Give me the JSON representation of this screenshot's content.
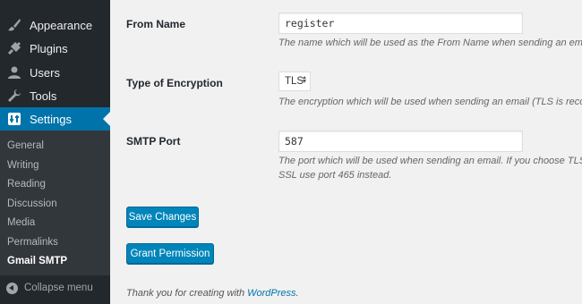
{
  "sidebar": {
    "menu": [
      {
        "label": "Appearance",
        "icon": "paintbrush-icon"
      },
      {
        "label": "Plugins",
        "icon": "plugin-icon"
      },
      {
        "label": "Users",
        "icon": "user-icon"
      },
      {
        "label": "Tools",
        "icon": "wrench-icon"
      },
      {
        "label": "Settings",
        "icon": "settings-icon"
      }
    ],
    "submenu": [
      "General",
      "Writing",
      "Reading",
      "Discussion",
      "Media",
      "Permalinks",
      "Gmail SMTP"
    ],
    "collapse_label": "Collapse menu"
  },
  "form": {
    "from_name": {
      "label": "From Name",
      "value": "register",
      "description": "The name which will be used as the From Name when sending an email."
    },
    "encryption": {
      "label": "Type of Encryption",
      "value": "TLS",
      "description": "The encryption which will be used when sending an email (TLS is recomm"
    },
    "smtp_port": {
      "label": "SMTP Port",
      "value": "587",
      "description_line1": "The port which will be used when sending an email. If you choose TLS it s",
      "description_line2": "SSL use port 465 instead."
    }
  },
  "buttons": {
    "save": "Save Changes",
    "grant": "Grant Permission"
  },
  "footer": {
    "text": "Thank you for creating with",
    "link": "WordPress",
    "end": "."
  },
  "colors": {
    "sidebar_bg": "#23282d",
    "submenu_bg": "#32373c",
    "accent": "#0073aa",
    "button": "#0085ba"
  }
}
